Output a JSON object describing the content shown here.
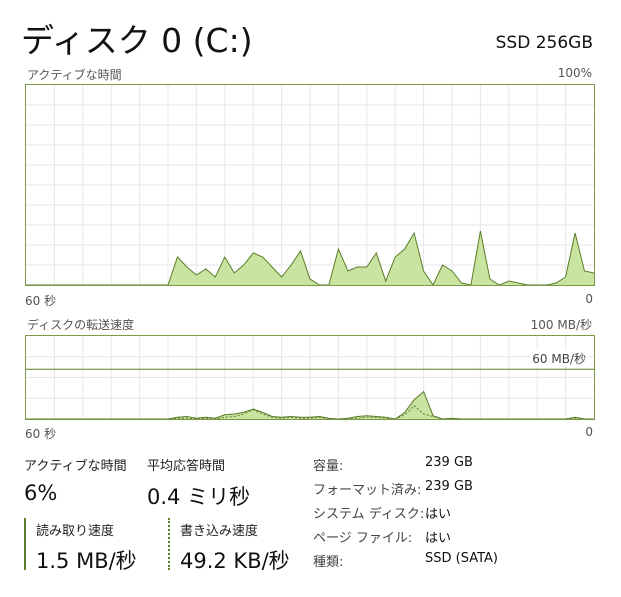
{
  "header": {
    "title": "ディスク 0 (C:)",
    "model": "SSD 256GB"
  },
  "active_time_chart": {
    "label": "アクティブな時間",
    "max_label": "100%",
    "x_left": "60 秒",
    "x_right": "0"
  },
  "transfer_chart": {
    "label": "ディスクの転送速度",
    "max_label": "100 MB/秒",
    "line_label": "60 MB/秒",
    "x_left": "60 秒",
    "x_right": "0"
  },
  "stats": {
    "active_time": {
      "label": "アクティブな時間",
      "value": "6%"
    },
    "avg_response": {
      "label": "平均応答時間",
      "value": "0.4 ミリ秒"
    },
    "read_speed": {
      "label": "読み取り速度",
      "value": "1.5 MB/秒"
    },
    "write_speed": {
      "label": "書き込み速度",
      "value": "49.2 KB/秒"
    }
  },
  "properties": [
    {
      "label": "容量:",
      "value": "239 GB"
    },
    {
      "label": "フォーマット済み:",
      "value": "239 GB"
    },
    {
      "label": "システム ディスク:",
      "value": "はい"
    },
    {
      "label": "ページ ファイル:",
      "value": "はい"
    },
    {
      "label": "種類:",
      "value": "SSD (SATA)"
    }
  ],
  "colors": {
    "accent_line": "#5a7d2a",
    "fill": "#c9e3a0",
    "grid": "#e6e6e6",
    "border": "#7a9a4a"
  },
  "chart_data": [
    {
      "type": "area",
      "title": "アクティブな時間",
      "ylim": [
        0,
        100
      ],
      "x": [
        60,
        59,
        58,
        57,
        56,
        55,
        54,
        53,
        52,
        51,
        50,
        49,
        48,
        47,
        46,
        45,
        44,
        43,
        42,
        41,
        40,
        39,
        38,
        37,
        36,
        35,
        34,
        33,
        32,
        31,
        30,
        29,
        28,
        27,
        26,
        25,
        24,
        23,
        22,
        21,
        20,
        19,
        18,
        17,
        16,
        15,
        14,
        13,
        12,
        11,
        10,
        9,
        8,
        7,
        6,
        5,
        4,
        3,
        2,
        1,
        0
      ],
      "values": [
        0,
        0,
        0,
        0,
        0,
        0,
        0,
        0,
        0,
        0,
        0,
        0,
        0,
        0,
        0,
        0,
        14,
        9,
        5,
        8,
        4,
        14,
        6,
        10,
        16,
        14,
        9,
        4,
        10,
        17,
        3,
        0,
        0,
        18,
        7,
        9,
        9,
        16,
        2,
        14,
        18,
        26,
        7,
        0,
        10,
        7,
        1,
        0,
        27,
        3,
        0,
        2,
        1,
        0,
        0,
        0,
        1,
        4,
        26,
        7,
        6
      ]
    },
    {
      "type": "area",
      "title": "ディスクの転送速度",
      "ylim": [
        0,
        100
      ],
      "series": [
        {
          "name": "読み取り速度",
          "values": [
            0,
            0,
            0,
            0,
            0,
            0,
            0,
            0,
            0,
            0,
            0,
            0,
            0,
            0,
            0,
            0,
            2,
            3,
            1,
            2,
            1,
            5,
            6,
            8,
            12,
            8,
            3,
            2,
            3,
            2,
            2,
            3,
            1,
            0,
            1,
            3,
            4,
            3,
            2,
            0,
            8,
            23,
            33,
            4,
            0,
            1,
            0,
            0,
            0,
            0,
            0,
            0,
            0,
            0,
            0,
            0,
            0,
            0,
            2,
            0,
            0
          ]
        },
        {
          "name": "書き込み速度",
          "values": [
            0,
            0,
            0,
            0,
            0,
            0,
            0,
            0,
            0,
            0,
            0,
            0,
            0,
            0,
            0,
            0,
            1,
            1,
            0,
            1,
            0,
            2,
            3,
            6,
            11,
            6,
            2,
            1,
            2,
            1,
            1,
            2,
            0,
            0,
            0,
            1,
            2,
            2,
            1,
            0,
            5,
            16,
            6,
            3,
            0,
            0,
            0,
            0,
            0,
            0,
            0,
            0,
            0,
            0,
            0,
            0,
            0,
            0,
            1,
            0,
            0
          ]
        }
      ]
    }
  ]
}
